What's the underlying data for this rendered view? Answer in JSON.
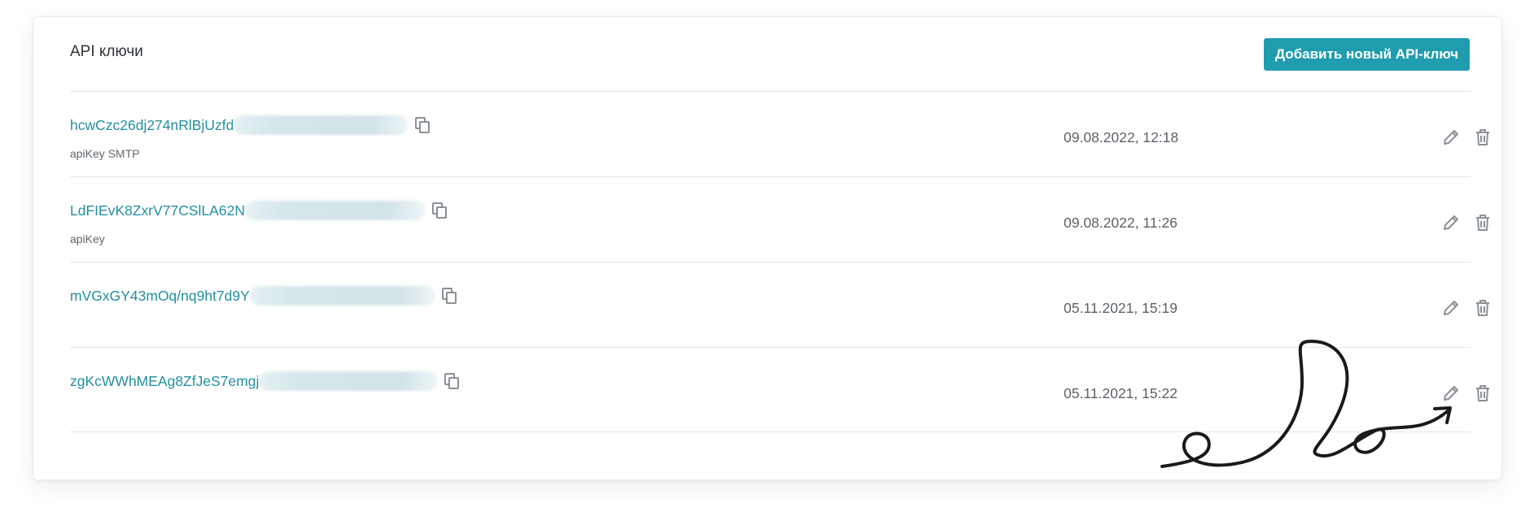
{
  "header": {
    "title": "API ключи",
    "add_button_label": "Добавить новый API-ключ"
  },
  "keys": [
    {
      "key": "hcwCzc26dj274nRlBjUzfd",
      "name": "apiKey SMTP",
      "date": "09.08.2022, 12:18"
    },
    {
      "key": "LdFIEvK8ZxrV77CSlLA62N",
      "name": "apiKey",
      "date": "09.08.2022, 11:26"
    },
    {
      "key": "mVGxGY43mOq/nq9ht7d9Y",
      "name": "",
      "date": "05.11.2021, 15:19"
    },
    {
      "key": "zgKcWWhMEAg8ZfJeS7emgj",
      "name": "",
      "date": "05.11.2021, 15:22"
    }
  ],
  "icons": {
    "copy": "copy-icon",
    "edit": "pencil-icon",
    "delete": "trash-icon"
  },
  "colors": {
    "accent": "#1f9daf",
    "link": "#238fa0",
    "icon": "#8a9096"
  }
}
